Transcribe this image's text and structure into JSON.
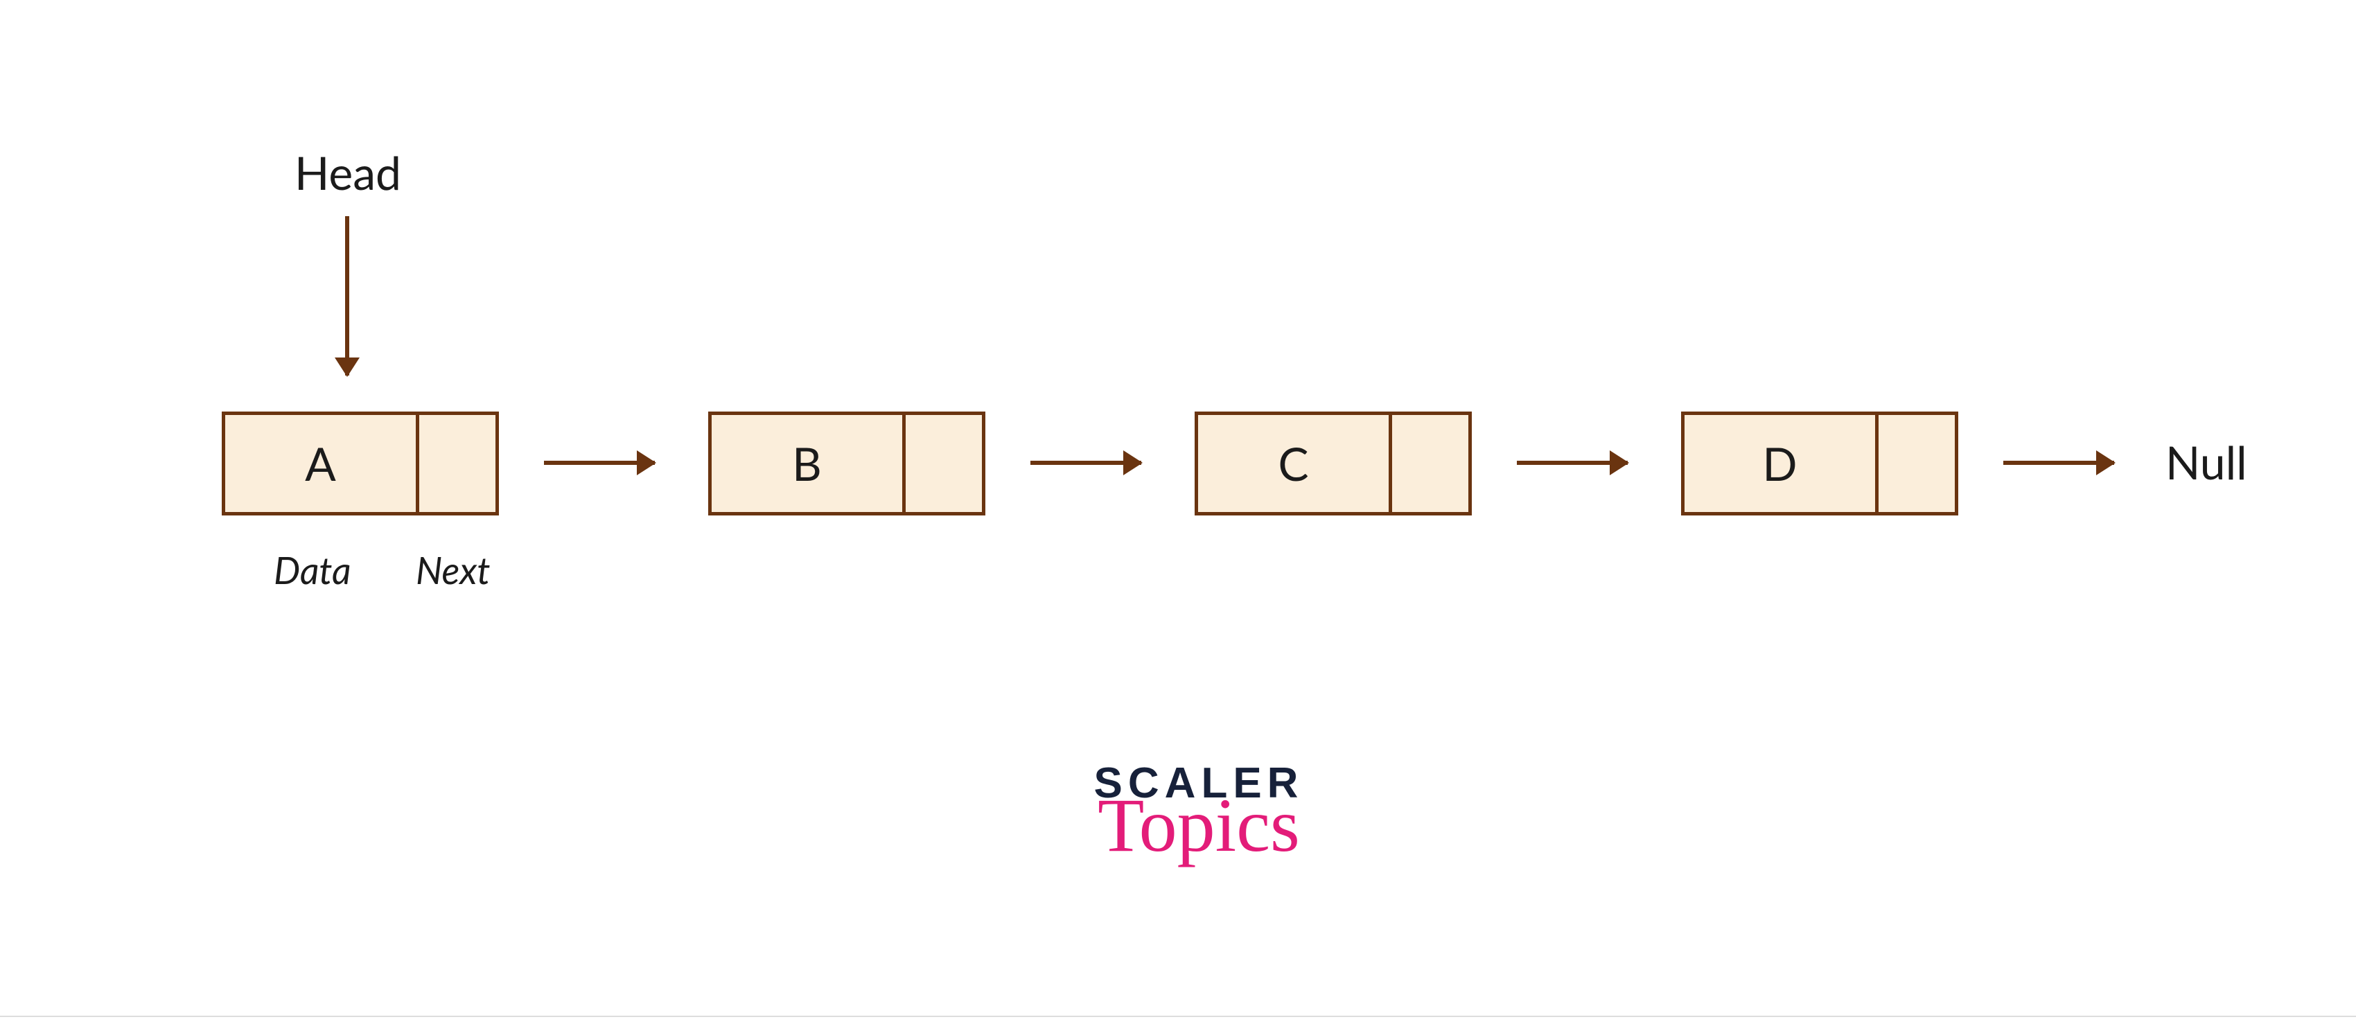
{
  "labels": {
    "head": "Head",
    "null": "Null",
    "data_field": "Data",
    "next_field": "Next"
  },
  "nodes": [
    {
      "value": "A"
    },
    {
      "value": "B"
    },
    {
      "value": "C"
    },
    {
      "value": "D"
    }
  ],
  "logo": {
    "line1": "SCALER",
    "line2": "Topics"
  },
  "colors": {
    "node_border": "#6a3410",
    "node_fill": "#fbeedb",
    "arrow": "#6a3410",
    "logo_dark": "#17213a",
    "logo_accent": "#e31c79"
  }
}
